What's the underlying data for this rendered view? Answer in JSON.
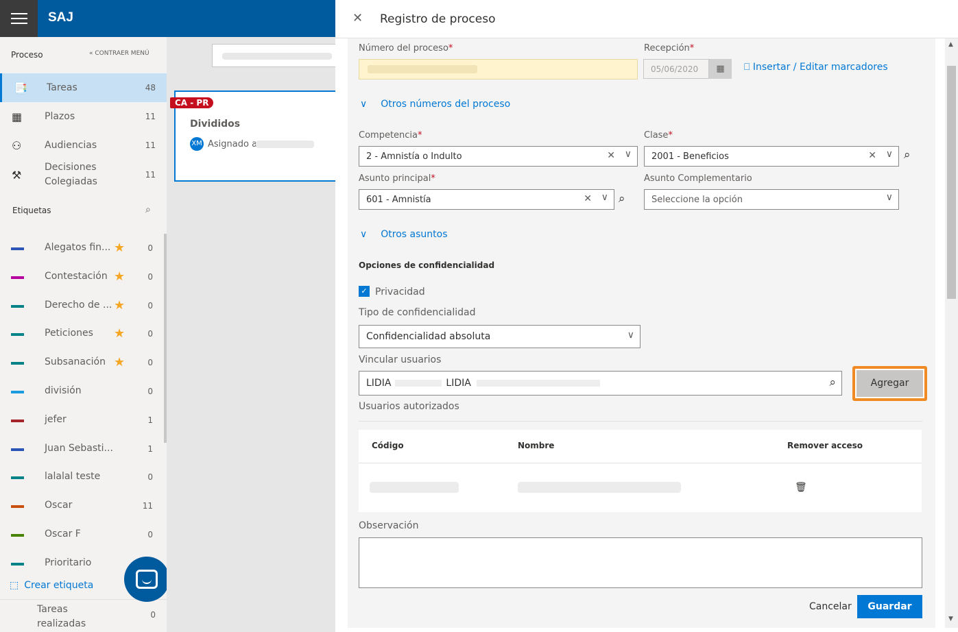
{
  "app": {
    "brand": "SAJ"
  },
  "sidebar": {
    "header": "Proceso",
    "collapse_label": "« CONTRAER MENÚ",
    "nav": [
      {
        "label": "Tareas",
        "count": "48",
        "icon": "book-icon"
      },
      {
        "label": "Plazos",
        "count": "11",
        "icon": "calendar-icon"
      },
      {
        "label": "Audiencias",
        "count": "11",
        "icon": "people-icon"
      },
      {
        "label": "Decisiones\nColegiadas",
        "count": "11",
        "icon": "gavel-icon"
      }
    ],
    "tags_header": "Etiquetas",
    "tags": [
      {
        "label": "Alegatos fin...",
        "count": "0",
        "color": "#2b56b8",
        "star": true
      },
      {
        "label": "Contestación",
        "count": "0",
        "color": "#b4009e",
        "star": true
      },
      {
        "label": "Derecho de ...",
        "count": "0",
        "color": "#038387",
        "star": true
      },
      {
        "label": "Peticiones",
        "count": "0",
        "color": "#038387",
        "star": true
      },
      {
        "label": "Subsanación",
        "count": "0",
        "color": "#038387",
        "star": true
      },
      {
        "label": "división",
        "count": "0",
        "color": "#1a9be0",
        "star": false
      },
      {
        "label": "jefer",
        "count": "1",
        "color": "#a4262c",
        "star": false
      },
      {
        "label": "Juan Sebasti...",
        "count": "1",
        "color": "#2b56b8",
        "star": false
      },
      {
        "label": "lalalal teste",
        "count": "0",
        "color": "#038387",
        "star": false
      },
      {
        "label": "Oscar",
        "count": "11",
        "color": "#ca5010",
        "star": false
      },
      {
        "label": "Oscar F",
        "count": "0",
        "color": "#498205",
        "star": false
      },
      {
        "label": "Prioritario",
        "count": "",
        "color": "#038387",
        "star": false
      }
    ],
    "create_tag": "Crear etiqueta",
    "done_tasks": {
      "label": "Tareas\nrealizadas",
      "count": "0"
    }
  },
  "card": {
    "badge": "CA - PR",
    "title": "Divididos",
    "avatar": "XM",
    "assigned": "Asignado a"
  },
  "panel": {
    "title": "Registro de proceso",
    "numero_label": "Número del proceso",
    "recepcion_label": "Recepción",
    "recepcion_value": "05/06/2020",
    "marcadores": "Insertar / Editar marcadores",
    "otros_numeros": "Otros números del proceso",
    "competencia_label": "Competencia",
    "competencia_value": "2 - Amnistía o Indulto",
    "clase_label": "Clase",
    "clase_value": "2001 - Beneficios",
    "asunto_label": "Asunto principal",
    "asunto_value": "601 - Amnistía",
    "asunto_comp_label": "Asunto Complementario",
    "asunto_comp_placeholder": "Seleccione la opción",
    "otros_asuntos": "Otros asuntos",
    "conf_opts": "Opciones de confidencialidad",
    "privacidad": "Privacidad",
    "tipo_label": "Tipo de confidencialidad",
    "tipo_value": "Confidencialidad absoluta",
    "vincular_label": "Vincular usuarios",
    "vincular_value_a": "LIDIA",
    "vincular_value_b": "LIDIA",
    "agregar": "Agregar",
    "autorizados": "Usuarios autorizados",
    "table_headers": {
      "codigo": "Código",
      "nombre": "Nombre",
      "remover": "Remover acceso"
    },
    "observacion": "Observación",
    "cancel": "Cancelar",
    "save": "Guardar"
  }
}
